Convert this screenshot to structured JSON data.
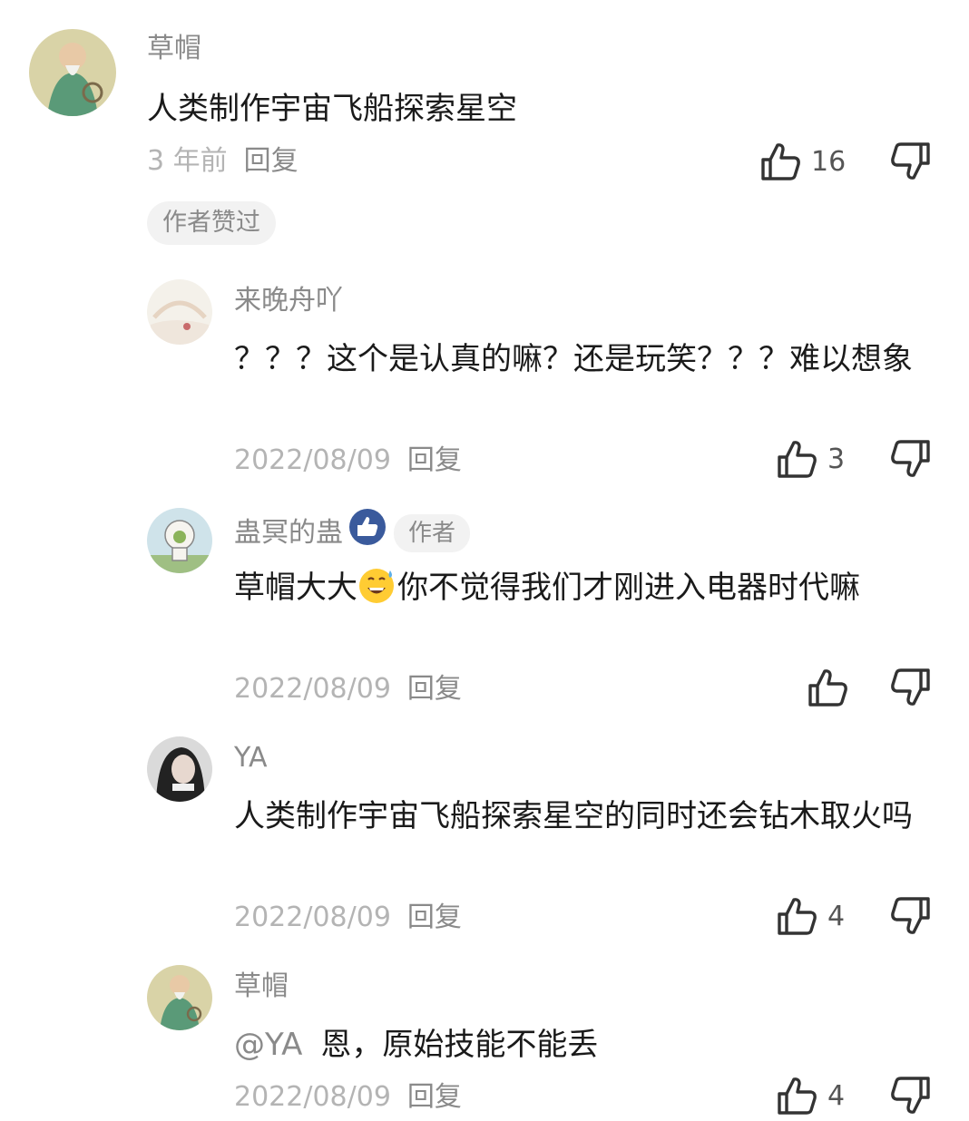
{
  "comments": [
    {
      "name": "草帽",
      "text": "人类制作宇宙飞船探索星空",
      "time": "3 年前",
      "reply": "回复",
      "likes": "16",
      "tag": "作者赞过"
    },
    {
      "name": "来晚舟吖",
      "text": "？？？这个是认真的嘛？还是玩笑？？？难以想象",
      "time": "2022/08/09",
      "reply": "回复",
      "likes": "3"
    },
    {
      "name": "蛊冥的蛊",
      "author_badge": "作者",
      "text_before": "草帽大大",
      "text_after": "你不觉得我们才刚进入电器时代嘛",
      "time": "2022/08/09",
      "reply": "回复",
      "likes": ""
    },
    {
      "name": "YA",
      "text": "人类制作宇宙飞船探索星空的同时还会钻木取火吗",
      "time": "2022/08/09",
      "reply": "回复",
      "likes": "4"
    },
    {
      "name": "草帽",
      "mention": "@YA",
      "text": "恩，原始技能不能丢",
      "time": "2022/08/09",
      "reply": "回复",
      "likes": "4"
    }
  ],
  "icons": {
    "like": "thumbs-up-icon",
    "dislike": "thumbs-down-icon",
    "verified": "verified-thumb-icon",
    "emoji": "grinning-sweat-emoji"
  },
  "colors": {
    "name": "#8a8a8a",
    "meta": "#b4b4b4",
    "text": "#1a1a1a",
    "tag_bg": "#f2f2f2",
    "verified_blue": "#3a5a9c"
  }
}
